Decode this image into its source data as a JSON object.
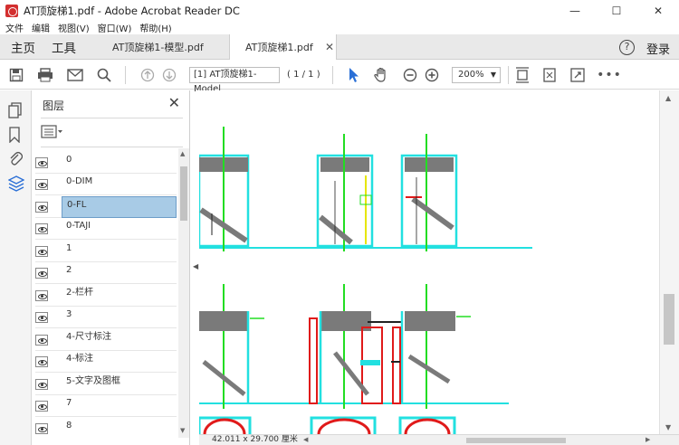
{
  "window": {
    "title": "AT顶旋梯1.pdf - Adobe Acrobat Reader DC"
  },
  "menu": {
    "items": [
      "文件",
      "编辑",
      "视图(V)",
      "窗口(W)",
      "帮助(H)"
    ]
  },
  "tabs": {
    "home": "主页",
    "tools": "工具",
    "docs": [
      {
        "label": "AT顶旋梯1-模型.pdf",
        "active": false
      },
      {
        "label": "AT顶旋梯1.pdf",
        "active": true
      }
    ],
    "signin": "登录"
  },
  "toolbar": {
    "page_field": "[1] AT顶旋梯1-Model",
    "page_count": "( 1 / 1 )",
    "zoom": "200%"
  },
  "layers": {
    "title": "图层",
    "items": [
      {
        "label": "0",
        "selected": false
      },
      {
        "label": "0-DIM",
        "selected": false
      },
      {
        "label": "0-FL",
        "selected": true
      },
      {
        "label": "0-TAJI",
        "selected": false
      },
      {
        "label": "1",
        "selected": false
      },
      {
        "label": "2",
        "selected": false
      },
      {
        "label": "2-栏杆",
        "selected": false
      },
      {
        "label": "3",
        "selected": false
      },
      {
        "label": "4-尺寸标注",
        "selected": false
      },
      {
        "label": "4-标注",
        "selected": false
      },
      {
        "label": "5-文字及图框",
        "selected": false
      },
      {
        "label": "7",
        "selected": false
      },
      {
        "label": "8",
        "selected": false
      }
    ]
  },
  "status": {
    "dimensions": "42.011 x 29.700 厘米"
  },
  "colors": {
    "drawing_green": "#22dd22",
    "drawing_cyan": "#22e0e0",
    "drawing_gray": "#7a7a7a",
    "drawing_red": "#e01a1a",
    "drawing_yellow": "#e6e600",
    "selection": "#a8cbe6",
    "cursor_blue": "#2a6fd6"
  }
}
